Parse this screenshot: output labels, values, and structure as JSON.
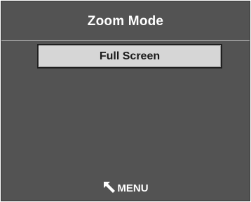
{
  "header": {
    "title": "Zoom Mode"
  },
  "options": [
    {
      "label": "Full Screen",
      "selected": true
    }
  ],
  "footer": {
    "menu_label": "MENU",
    "menu_icon": "return-arrow-icon"
  },
  "colors": {
    "background": "#535353",
    "option_background": "#d6d6d6",
    "divider": "#c9c9c9",
    "text_light": "#ffffff",
    "text_dark": "#1a1a1a"
  }
}
